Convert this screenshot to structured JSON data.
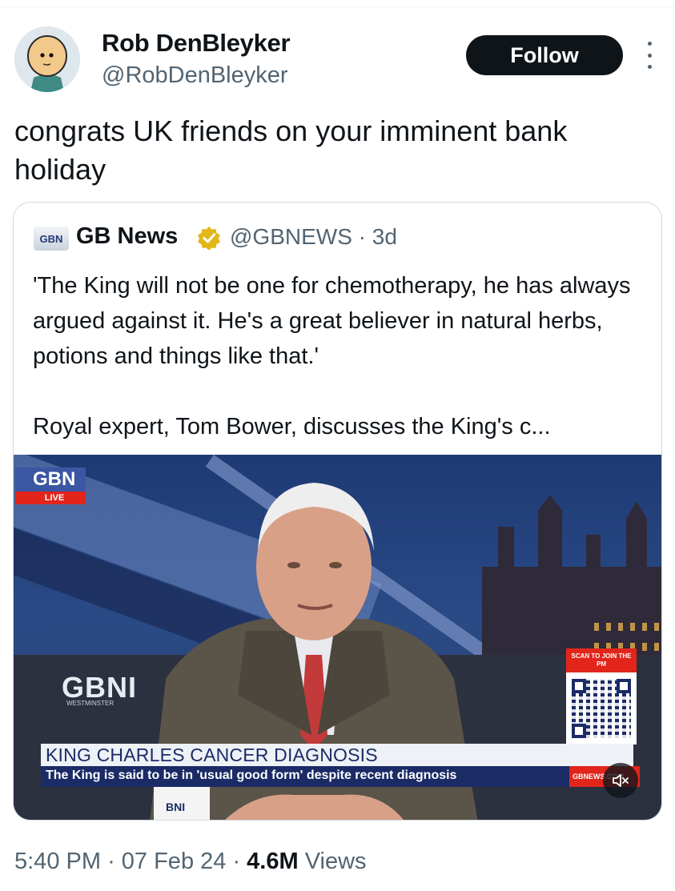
{
  "author": {
    "name": "Rob DenBleyker",
    "handle": "@RobDenBleyker",
    "follow_label": "Follow",
    "more_icon": "more-vertical-icon"
  },
  "tweet": {
    "text": "congrats UK friends on your imminent bank holiday"
  },
  "quoted": {
    "logo_text": "GBN",
    "name": "GB News",
    "verified": true,
    "badge_color": "#e2b719",
    "handle_time": "@GBNEWS · 3d",
    "paragraph1": "'The King will not be one for chemotherapy, he has always argued against it. He's a great believer in natural herbs, potions and things like that.'",
    "paragraph2": "Royal expert, Tom Bower, discusses the King's c..."
  },
  "video": {
    "channel_logo": "GBN",
    "live_label": "LIVE",
    "desk_logo": "GBNI",
    "desk_sub": "WESTMINSTER",
    "qr_heading": "SCAN TO JOIN THE PM",
    "headline": "KING CHARLES CANCER DIAGNOSIS",
    "ticker": "The King is said to be in 'usual good form' despite recent diagnosis",
    "site": "GBNEWS.COM",
    "mug_text": "BNI",
    "mute_icon": "speaker-muted-icon"
  },
  "meta": {
    "time": "5:40 PM",
    "date": "07 Feb 24",
    "views_count": "4.6M",
    "views_label": "Views"
  }
}
